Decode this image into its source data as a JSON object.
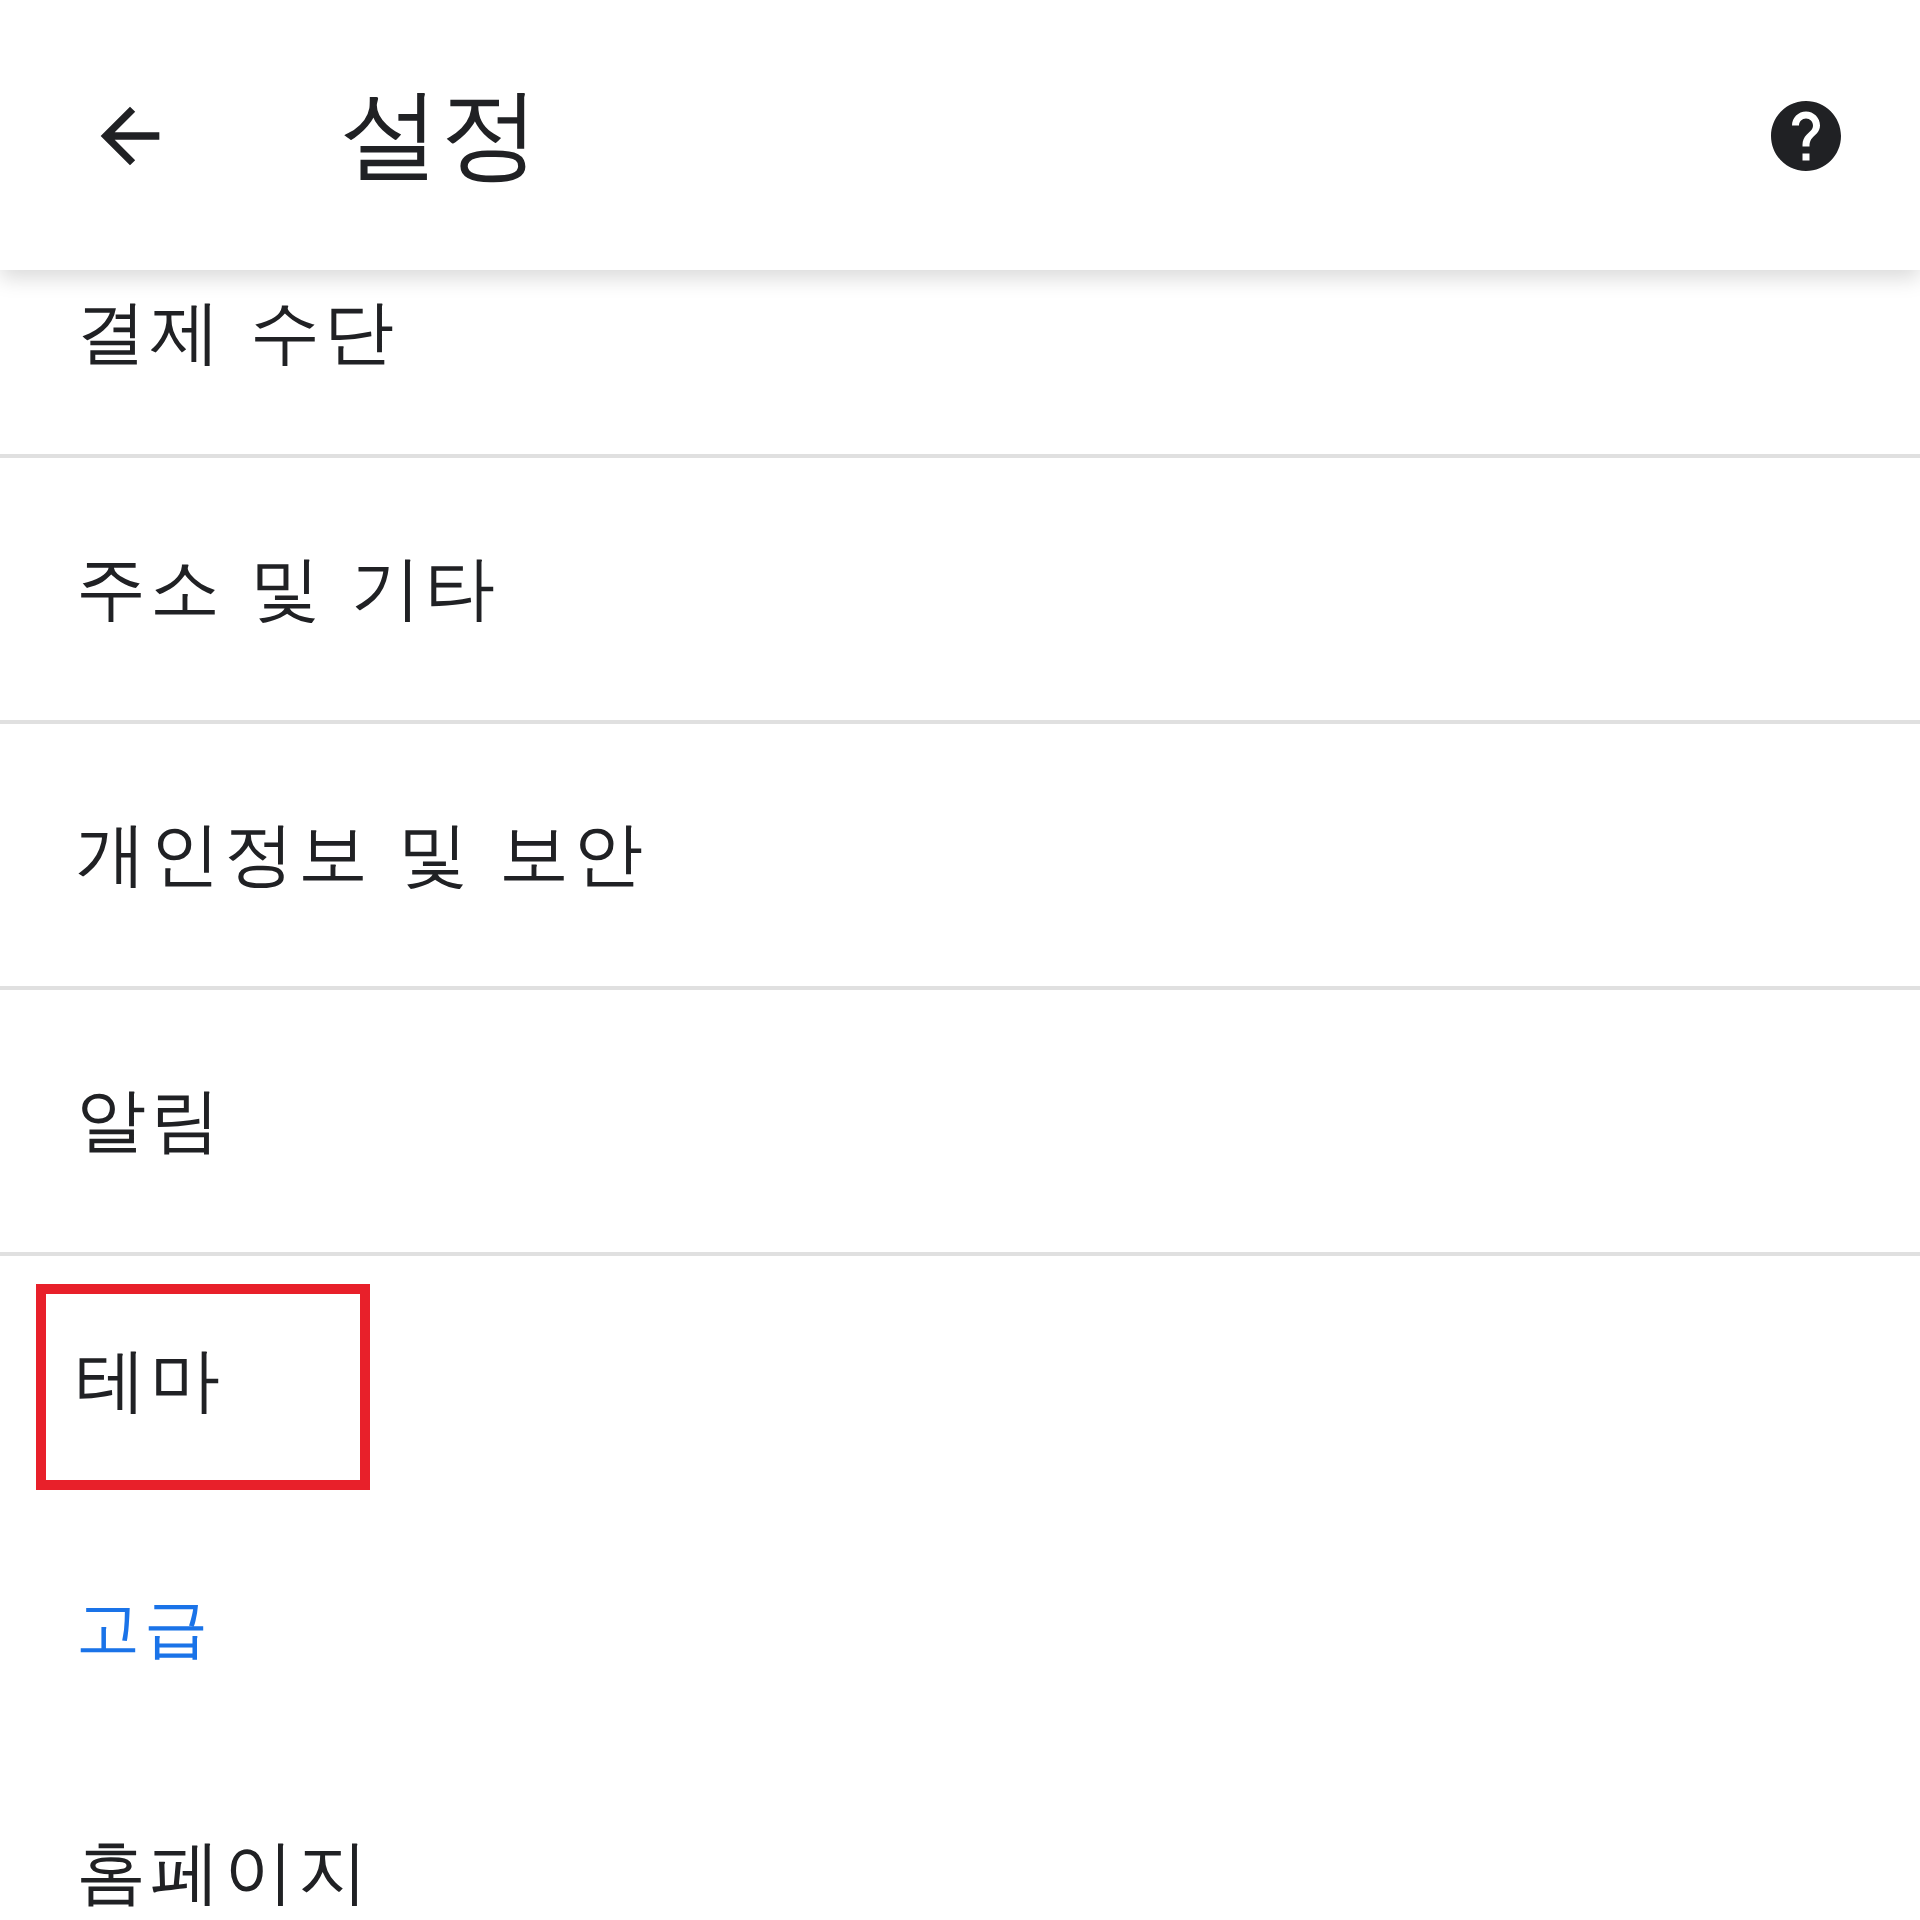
{
  "app_bar": {
    "title": "설정"
  },
  "items": [
    {
      "kind": "item",
      "label": "결제 수단",
      "highlighted": false
    },
    {
      "kind": "item",
      "label": "주소 및 기타",
      "highlighted": false
    },
    {
      "kind": "item",
      "label": "개인정보 및 보안",
      "highlighted": false
    },
    {
      "kind": "item",
      "label": "알림",
      "highlighted": false
    },
    {
      "kind": "item",
      "label": "테마",
      "highlighted": true
    },
    {
      "kind": "section_header",
      "label": "고급",
      "highlighted": false
    },
    {
      "kind": "item",
      "label": "홈페이지",
      "highlighted": false
    }
  ]
}
